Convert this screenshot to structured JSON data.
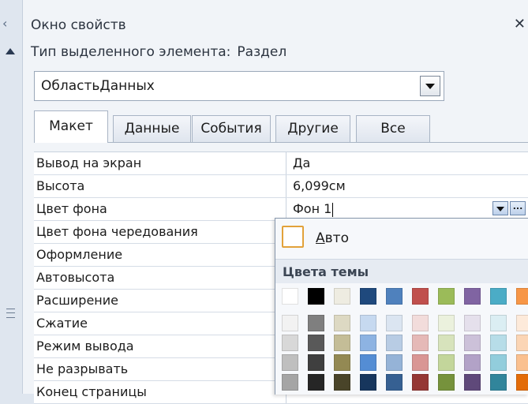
{
  "pane": {
    "title": "Окно свойств",
    "close_glyph": "✕",
    "selection_type_label": "Тип выделенного элемента:",
    "selection_type_value": "Раздел",
    "object_selector_value": "ОбластьДанных"
  },
  "tabs": [
    {
      "label": "Макет",
      "active": true
    },
    {
      "label": "Данные",
      "active": false
    },
    {
      "label": "События",
      "active": false
    },
    {
      "label": "Другие",
      "active": false
    },
    {
      "label": "Все",
      "active": false
    }
  ],
  "properties": [
    {
      "name": "Вывод на экран",
      "value": "Да"
    },
    {
      "name": "Высота",
      "value": "6,099см"
    },
    {
      "name": "Цвет фона",
      "value": "Фон 1"
    },
    {
      "name": "Цвет фона чередования",
      "value": ""
    },
    {
      "name": "Оформление",
      "value": ""
    },
    {
      "name": "Автовысота",
      "value": ""
    },
    {
      "name": "Расширение",
      "value": ""
    },
    {
      "name": "Сжатие",
      "value": ""
    },
    {
      "name": "Режим вывода",
      "value": ""
    },
    {
      "name": "Не разрывать",
      "value": ""
    },
    {
      "name": "Конец страницы",
      "value": ""
    }
  ],
  "color_row": {
    "more_button_label": "...",
    "icons": [
      "chevron-down-icon",
      "ellipsis-icon"
    ]
  },
  "palette": {
    "auto_label_accel": "А",
    "auto_label_rest": "вто",
    "theme_heading": "Цвета темы",
    "theme_colors": [
      "#ffffff",
      "#000000",
      "#eeece1",
      "#1f497d",
      "#4f81bd",
      "#c0504d",
      "#9bbb59",
      "#8064a2",
      "#4bacc6",
      "#f79646"
    ],
    "tint_columns": [
      [
        "#f2f2f2",
        "#d8d8d8",
        "#bfbfbf",
        "#a5a5a5",
        "#7f7f7f"
      ],
      [
        "#7f7f7f",
        "#595959",
        "#3f3f3f",
        "#262626",
        "#0c0c0c"
      ],
      [
        "#ddd9c3",
        "#c4bd97",
        "#938953",
        "#494429",
        "#1d1b10"
      ],
      [
        "#c6d9f0",
        "#8db3e2",
        "#548dd4",
        "#17365d",
        "#0f243e"
      ],
      [
        "#dbe5f1",
        "#b8cce4",
        "#95b3d7",
        "#366092",
        "#244061"
      ],
      [
        "#f2dcdb",
        "#e5b9b7",
        "#d99694",
        "#953734",
        "#632423"
      ],
      [
        "#ebf1dd",
        "#d7e3bc",
        "#c3d69b",
        "#76923c",
        "#4f6128"
      ],
      [
        "#e5e0ec",
        "#ccc1d9",
        "#b2a2c7",
        "#5f497a",
        "#3f3151"
      ],
      [
        "#dbeef3",
        "#b7dde8",
        "#92cddc",
        "#31859b",
        "#205867"
      ],
      [
        "#fdeada",
        "#fbd5b5",
        "#fac08f",
        "#e36c09",
        "#974806"
      ]
    ]
  },
  "colors": {
    "pane_bg": "#f1f4f8",
    "auto_swatch_border": "#e2a23a",
    "tab_active_bg": "#ffffff"
  }
}
